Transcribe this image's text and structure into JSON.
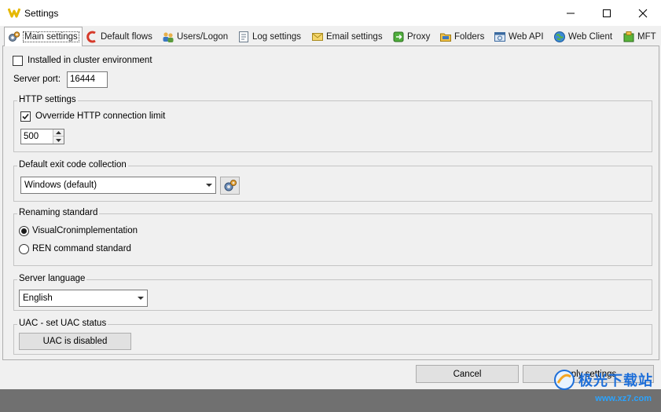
{
  "window": {
    "title": "Settings"
  },
  "tabs": [
    {
      "label": "Main settings",
      "icon": "gear-settings-icon",
      "active": true
    },
    {
      "label": "Default flows",
      "icon": "flow-icon"
    },
    {
      "label": "Users/Logon",
      "icon": "users-icon"
    },
    {
      "label": "Log settings",
      "icon": "log-icon"
    },
    {
      "label": "Email settings",
      "icon": "email-icon"
    },
    {
      "label": "Proxy",
      "icon": "proxy-icon"
    },
    {
      "label": "Folders",
      "icon": "folders-icon"
    },
    {
      "label": "Web API",
      "icon": "web-api-icon"
    },
    {
      "label": "Web Client",
      "icon": "web-client-icon"
    },
    {
      "label": "MFT",
      "icon": "mft-icon"
    }
  ],
  "main": {
    "cluster_label": "Installed in cluster environment",
    "cluster_checked": false,
    "server_port_label": "Server port:",
    "server_port_value": "16444",
    "http": {
      "title": "HTTP settings",
      "override_label": "Ovverride HTTP connection limit",
      "override_checked": true,
      "limit_value": "500"
    },
    "exit_code": {
      "title": "Default exit code collection",
      "selected": "Windows (default)"
    },
    "renaming": {
      "title": "Renaming standard",
      "option1": "VisualCronimplementation",
      "option2": "REN command standard",
      "selected": "VisualCronimplementation"
    },
    "language": {
      "title": "Server language",
      "selected": "English"
    },
    "uac": {
      "title": "UAC - set UAC status",
      "button_label": "UAC is disabled"
    }
  },
  "footer": {
    "cancel_label": "Cancel",
    "apply_label": "Apply settings"
  },
  "watermark": {
    "text": "极光下载站",
    "url": "www.xz7.com"
  }
}
